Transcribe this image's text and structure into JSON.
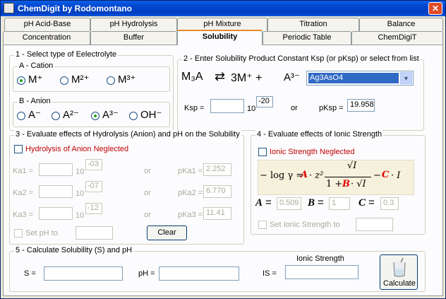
{
  "window": {
    "title": "ChemDigit by Rodomontano",
    "close": "✕"
  },
  "tabs_row1": [
    "pH Acid-Base",
    "pH Hydrolysis",
    "pH Mixture",
    "Titration",
    "Balance"
  ],
  "tabs_row2": [
    "Concentration",
    "Buffer",
    "Solubility",
    "Periodic Table",
    "ChemDigiT"
  ],
  "s1": {
    "title": "1 - Select type of Eelectrolyte",
    "cation_title": "A - Cation",
    "cations": [
      "M⁺",
      "M²⁺",
      "M³⁺"
    ],
    "cation_selected": 0,
    "anion_title": "B - Anion",
    "anions": [
      "A⁻",
      "A²⁻",
      "A³⁻",
      "OH⁻"
    ],
    "anion_selected": 2
  },
  "s2": {
    "title": "2 - Enter Solubility Product Constant Ksp (or pKsp) or select from list",
    "eq_left": "M₃A",
    "eq_arrow": "⇄",
    "eq_right": "3M⁺  +",
    "eq_anion": "A³⁻",
    "compound": "Ag3AsO4",
    "ksp_label": "Ksp  =",
    "ksp_value": "",
    "ten": "10",
    "exponent": "-20",
    "or": "or",
    "pksp_label": "pKsp =",
    "pksp_value": "19.958"
  },
  "s3": {
    "title": "3 - Evaluate effects of Hydrolysis (Anion) and pH on the Solubility",
    "hydrolysis_label": "Hydrolysis of Anion Neglected",
    "rows": [
      {
        "ka": "Ka1  =",
        "exp": "-03",
        "pka": "pKa1 =",
        "pka_value": "2.252"
      },
      {
        "ka": "Ka2  =",
        "exp": "-07",
        "pka": "pKa2 =",
        "pka_value": "6.770"
      },
      {
        "ka": "Ka3  =",
        "exp": "-12",
        "pka": "pKa3 =",
        "pka_value": "11.41"
      }
    ],
    "ten": "10",
    "or": "or",
    "set_ph": "Set pH to",
    "clear": "Clear"
  },
  "s4": {
    "title": "4 - Evaluate effects of Ionic Strength",
    "ionic_label": "Ionic Strength Neglected",
    "formula_prefix": "− log γ =",
    "a_label": "A",
    "a_value": "0.509",
    "b_label": "B",
    "b_value": "1",
    "c_label": "C",
    "c_value": "0.3",
    "set_ionic": "Set Ionic Strength to"
  },
  "s5": {
    "title": "5 - Calculate Solubility (S) and pH",
    "s_label": "S =",
    "ph_label": "pH =",
    "is_label": "IS =",
    "ionic_strength": "Ionic Strength",
    "calculate": "Calculate"
  }
}
